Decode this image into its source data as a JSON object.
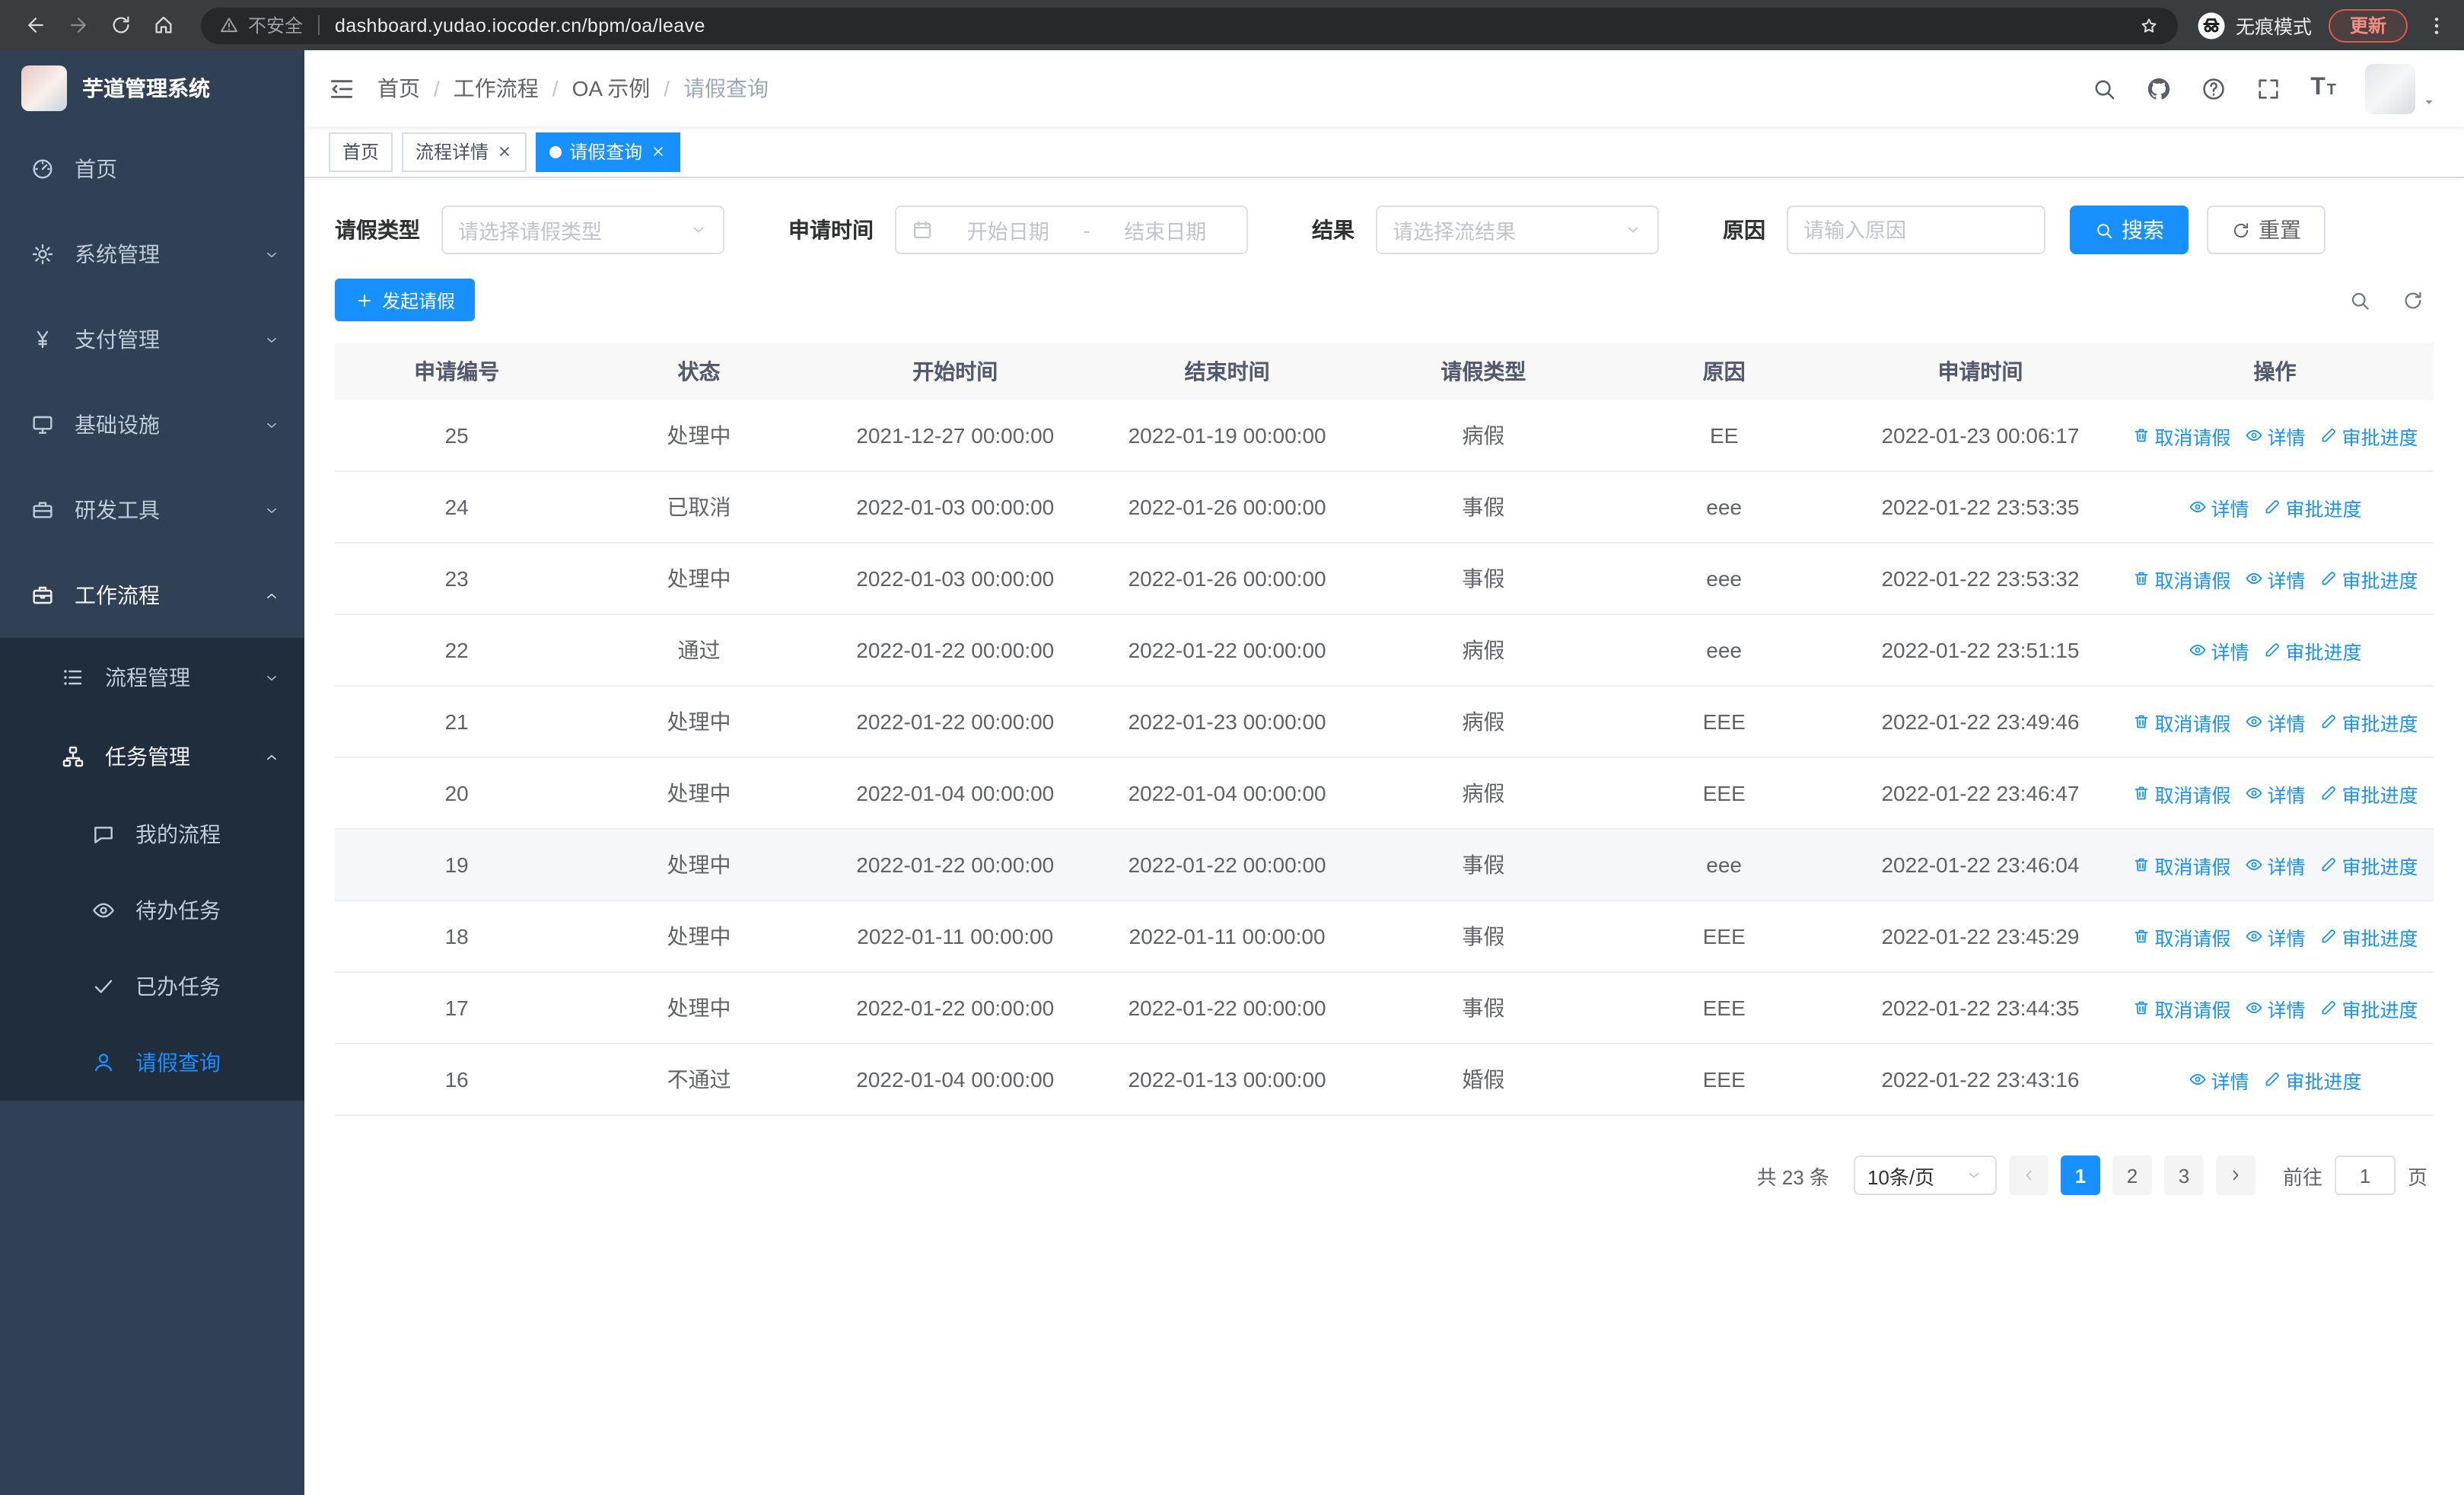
{
  "colors": {
    "primary": "#1890ff",
    "sidebar_bg": "#304156",
    "submenu_bg": "#1f2d3d",
    "sidebar_text": "#bfcbd9",
    "table_header_bg": "#f8f8f9",
    "border": "#dcdfe6",
    "update_pill": "#e2574c"
  },
  "browser": {
    "security_label": "不安全",
    "url": "dashboard.yudao.iocoder.cn/bpm/oa/leave",
    "incognito_label": "无痕模式",
    "update_label": "更新"
  },
  "icons": {
    "back": "left-arrow",
    "forward": "right-arrow",
    "reload": "circular-arrow",
    "home": "house",
    "warning": "triangle-exclamation",
    "star": "bookmark-star",
    "incognito": "hat-and-glasses",
    "dots-vertical": "kebab-menu",
    "collapse": "hamburger-fold",
    "search": "magnifier",
    "github": "octocat",
    "question": "question-circle",
    "fullscreen": "expand-corners",
    "fontsize": "large-and-small-T",
    "calendar": "calendar",
    "refresh": "circular-arrow",
    "plus": "plus",
    "trash": "trash-bin",
    "eye": "eye",
    "pen": "pen"
  },
  "sidebar": {
    "logo_title": "芋道管理系统",
    "items": [
      {
        "key": "home",
        "label": "首页",
        "icon": "dashboard",
        "level": 1
      },
      {
        "key": "system",
        "label": "系统管理",
        "icon": "gear",
        "level": 1,
        "chevron": "down"
      },
      {
        "key": "payment",
        "label": "支付管理",
        "icon": "yen",
        "level": 1,
        "chevron": "down"
      },
      {
        "key": "infra",
        "label": "基础设施",
        "icon": "monitor",
        "level": 1,
        "chevron": "down"
      },
      {
        "key": "devtools",
        "label": "研发工具",
        "icon": "toolbox",
        "level": 1,
        "chevron": "down"
      },
      {
        "key": "workflow",
        "label": "工作流程",
        "icon": "briefcase",
        "level": 1,
        "chevron": "up",
        "expanded": true
      },
      {
        "key": "process-mgmt",
        "label": "流程管理",
        "icon": "list",
        "level": 2,
        "sub": true,
        "chevron": "down"
      },
      {
        "key": "task-mgmt",
        "label": "任务管理",
        "icon": "org",
        "level": 2,
        "sub": true,
        "chevron": "up",
        "expanded": true
      },
      {
        "key": "my-process",
        "label": "我的流程",
        "icon": "chat",
        "level": 3,
        "sub": true
      },
      {
        "key": "todo-tasks",
        "label": "待办任务",
        "icon": "eye",
        "level": 3,
        "sub": true
      },
      {
        "key": "done-tasks",
        "label": "已办任务",
        "icon": "done",
        "level": 3,
        "sub": true
      },
      {
        "key": "leave-query",
        "label": "请假查询",
        "icon": "user",
        "level": 3,
        "sub": true,
        "active": true
      }
    ]
  },
  "header": {
    "breadcrumb": [
      "首页",
      "工作流程",
      "OA 示例",
      "请假查询"
    ],
    "breadcrumb_separator": "/"
  },
  "tabs": [
    {
      "key": "home",
      "label": "首页"
    },
    {
      "key": "process-detail",
      "label": "流程详情",
      "closable": true
    },
    {
      "key": "leave-query",
      "label": "请假查询",
      "closable": true,
      "active": true
    }
  ],
  "filters": {
    "leave_type_label": "请假类型",
    "leave_type_placeholder": "请选择请假类型",
    "apply_time_label": "申请时间",
    "start_date_placeholder": "开始日期",
    "date_separator": "-",
    "end_date_placeholder": "结束日期",
    "result_label": "结果",
    "result_placeholder": "请选择流结果",
    "reason_label": "原因",
    "reason_placeholder": "请输入原因",
    "search_label": "搜索",
    "reset_label": "重置"
  },
  "toolbar": {
    "create_label": "发起请假"
  },
  "table": {
    "columns": [
      "申请编号",
      "状态",
      "开始时间",
      "结束时间",
      "请假类型",
      "原因",
      "申请时间",
      "操作"
    ],
    "action_labels": {
      "cancel": "取消请假",
      "detail": "详情",
      "progress": "审批进度"
    },
    "rows": [
      {
        "id": "25",
        "status": "处理中",
        "start": "2021-12-27 00:00:00",
        "end": "2022-01-19 00:00:00",
        "type": "病假",
        "reason": "EE",
        "applied": "2022-01-23 00:06:17",
        "actions": [
          "cancel",
          "detail",
          "progress"
        ]
      },
      {
        "id": "24",
        "status": "已取消",
        "start": "2022-01-03 00:00:00",
        "end": "2022-01-26 00:00:00",
        "type": "事假",
        "reason": "eee",
        "applied": "2022-01-22 23:53:35",
        "actions": [
          "detail",
          "progress"
        ]
      },
      {
        "id": "23",
        "status": "处理中",
        "start": "2022-01-03 00:00:00",
        "end": "2022-01-26 00:00:00",
        "type": "事假",
        "reason": "eee",
        "applied": "2022-01-22 23:53:32",
        "actions": [
          "cancel",
          "detail",
          "progress"
        ]
      },
      {
        "id": "22",
        "status": "通过",
        "start": "2022-01-22 00:00:00",
        "end": "2022-01-22 00:00:00",
        "type": "病假",
        "reason": "eee",
        "applied": "2022-01-22 23:51:15",
        "actions": [
          "detail",
          "progress"
        ]
      },
      {
        "id": "21",
        "status": "处理中",
        "start": "2022-01-22 00:00:00",
        "end": "2022-01-23 00:00:00",
        "type": "病假",
        "reason": "EEE",
        "applied": "2022-01-22 23:49:46",
        "actions": [
          "cancel",
          "detail",
          "progress"
        ]
      },
      {
        "id": "20",
        "status": "处理中",
        "start": "2022-01-04 00:00:00",
        "end": "2022-01-04 00:00:00",
        "type": "病假",
        "reason": "EEE",
        "applied": "2022-01-22 23:46:47",
        "actions": [
          "cancel",
          "detail",
          "progress"
        ]
      },
      {
        "id": "19",
        "status": "处理中",
        "start": "2022-01-22 00:00:00",
        "end": "2022-01-22 00:00:00",
        "type": "事假",
        "reason": "eee",
        "applied": "2022-01-22 23:46:04",
        "actions": [
          "cancel",
          "detail",
          "progress"
        ],
        "highlighted": true
      },
      {
        "id": "18",
        "status": "处理中",
        "start": "2022-01-11 00:00:00",
        "end": "2022-01-11 00:00:00",
        "type": "事假",
        "reason": "EEE",
        "applied": "2022-01-22 23:45:29",
        "actions": [
          "cancel",
          "detail",
          "progress"
        ]
      },
      {
        "id": "17",
        "status": "处理中",
        "start": "2022-01-22 00:00:00",
        "end": "2022-01-22 00:00:00",
        "type": "事假",
        "reason": "EEE",
        "applied": "2022-01-22 23:44:35",
        "actions": [
          "cancel",
          "detail",
          "progress"
        ]
      },
      {
        "id": "16",
        "status": "不通过",
        "start": "2022-01-04 00:00:00",
        "end": "2022-01-13 00:00:00",
        "type": "婚假",
        "reason": "EEE",
        "applied": "2022-01-22 23:43:16",
        "actions": [
          "detail",
          "progress"
        ]
      }
    ]
  },
  "pagination": {
    "total_label": "共 23 条",
    "page_size": "10条/页",
    "pages": [
      "1",
      "2",
      "3"
    ],
    "active_page": "1",
    "goto_label": "前往",
    "goto_value": "1",
    "page_unit": "页"
  }
}
